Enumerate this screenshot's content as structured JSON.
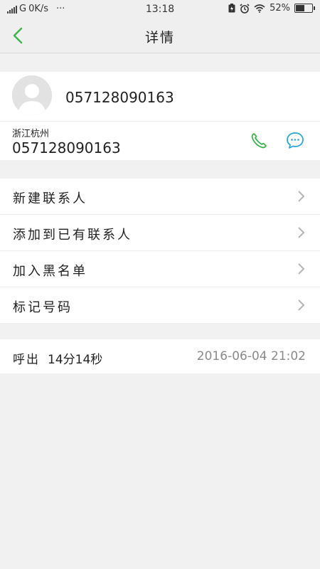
{
  "status_bar": {
    "carrier": "G",
    "net_speed": "0K/s",
    "more": "···",
    "time": "13:18",
    "battery": "52%"
  },
  "header": {
    "title": "详情"
  },
  "contact": {
    "name": "057128090163",
    "location": "浙江杭州",
    "number": "057128090163"
  },
  "menu": {
    "items": [
      {
        "label": "新建联系人"
      },
      {
        "label": "添加到已有联系人"
      },
      {
        "label": "加入黑名单"
      },
      {
        "label": "标记号码"
      }
    ]
  },
  "call_log": {
    "type": "呼出",
    "duration": "14分14秒",
    "time": "2016-06-04  21:02"
  },
  "colors": {
    "accent_green": "#3bb54a",
    "accent_teal": "#29a7d8",
    "chevron": "#b5b5b5"
  }
}
